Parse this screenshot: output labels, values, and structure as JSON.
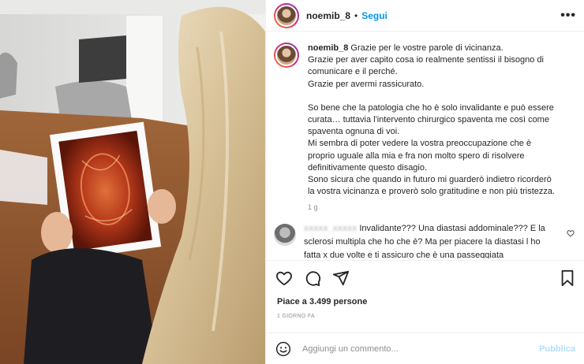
{
  "header": {
    "username": "noemib_8",
    "separator": "•",
    "follow_label": "Segui",
    "more_label": "•••"
  },
  "caption": {
    "username": "noemib_8",
    "lines": [
      "Grazie per le vostre parole di vicinanza.",
      "Grazie per aver capito cosa io realmente sentissi il bisogno di",
      "comunicare e il perché.",
      "Grazie per avermi rassicurato.",
      "",
      "So bene che la patologia che ho è solo invalidante e può essere",
      "curata… tuttavia l'intervento chirurgico spaventa me così come",
      "spaventa ognuna di voi.",
      "Mi sembra di poter vedere la vostra preoccupazione che è",
      "proprio uguale alla mia e fra non molto spero di risolvere",
      "definitivamente questo disagio.",
      "Sono sicura che quando in futuro mi guarderò indietro ricorderò",
      "la vostra vicinanza e proverò solo gratitudine e non più tristezza."
    ],
    "time": "1 g"
  },
  "comment": {
    "username": "xxxxx_xxxxx",
    "first_line": "Invalidante??? Una diastasi addominale??? E la",
    "lines": [
      "sclerosi multipla che ho che è? Ma per piacere la diastasi l ho",
      "fatta x due volte e ti assicuro che è una passeggiata"
    ]
  },
  "actions": {
    "icons": [
      "heart-icon",
      "comment-icon",
      "share-icon",
      "bookmark-icon"
    ]
  },
  "likes_text": "Piace a 3.499 persone",
  "date_text": "1 GIORNO FA",
  "add_comment": {
    "placeholder": "Aggiungi un commento...",
    "publish_label": "Pubblica"
  },
  "colors": {
    "accent": "#0095f6",
    "publish_disabled": "#b2dffc",
    "muted": "#8e8e8e"
  }
}
